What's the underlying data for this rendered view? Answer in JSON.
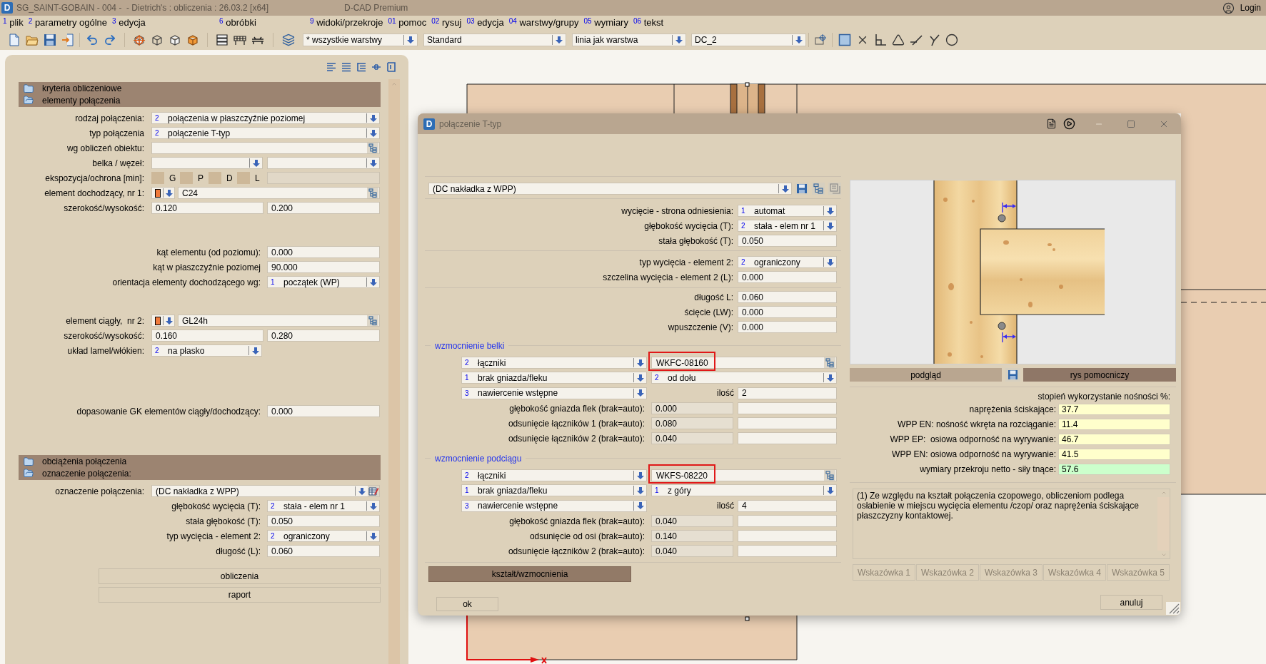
{
  "window": {
    "logo": "D",
    "title": "SG_SAINT-GOBAIN - 004 -  - Dietrich's : obliczenia : 26.03.2 [x64]",
    "app_name": "D-CAD Premium",
    "login": "Login"
  },
  "menu": [
    [
      {
        "number": "1",
        "label": "plik"
      },
      {
        "number": "2",
        "label": "parametry ogólne"
      },
      {
        "number": "3",
        "label": "edycja"
      }
    ],
    [
      {
        "number": "6",
        "label": "obróbki"
      }
    ],
    [
      {
        "number": "9",
        "label": "widoki/przekroje"
      },
      {
        "number": "01",
        "label": "pomoc"
      },
      {
        "number": "02",
        "label": "rysuj"
      },
      {
        "number": "03",
        "label": "edycja"
      },
      {
        "number": "04",
        "label": "warstwy/grupy"
      },
      {
        "number": "05",
        "label": "wymiary"
      },
      {
        "number": "06",
        "label": "tekst"
      }
    ]
  ],
  "toolbar": {
    "dropdowns": [
      "* wszystkie warstwy",
      "Standard",
      "linia jak warstwa",
      "DC_2"
    ]
  },
  "left_panel": {
    "sections": [
      {
        "headers": [
          {
            "label": "kryteria obliczeniowe",
            "expanded": false
          },
          {
            "label": "elementy połączenia",
            "expanded": true
          }
        ],
        "groups": [
          [
            {
              "kind": "select",
              "label": "rodzaj połączenia:",
              "number": "2",
              "value": "połączenia w płaszczyźnie poziomej"
            },
            {
              "kind": "select",
              "label": "typ połączenia",
              "number": "2",
              "value": "połączenie T-typ"
            },
            {
              "kind": "lookup",
              "label": "wg obliczeń obiektu:"
            },
            {
              "kind": "select_pair",
              "label": "belka / węzeł:"
            },
            {
              "kind": "exposure",
              "label": "ekspozycja/ochrona [min]:",
              "options": [
                {
                  "label": "G",
                  "checked": false
                },
                {
                  "label": "P",
                  "checked": false
                },
                {
                  "label": "D",
                  "checked": false
                },
                {
                  "label": "L",
                  "checked": false
                }
              ]
            },
            {
              "kind": "material",
              "label": "element dochodzący, nr 1:",
              "color": "#f07a3c",
              "value": "C24"
            },
            {
              "kind": "pair",
              "label": "szerokość/wysokość:",
              "values": [
                "0.120",
                "0.200"
              ]
            }
          ],
          [
            {
              "kind": "value_right",
              "label": "kąt elementu (od poziomu):",
              "value": "0.000"
            },
            {
              "kind": "value_right",
              "label": "kąt w płaszczyźnie poziomej",
              "value": "90.000"
            },
            {
              "kind": "select_right",
              "label": "orientacja elementy dochodzącego wg:",
              "number": "1",
              "value": "początek (WP)"
            }
          ],
          [
            {
              "kind": "material",
              "label": "element ciągły,  nr 2:",
              "color": "#f07a3c",
              "value": "GL24h"
            },
            {
              "kind": "pair",
              "label": "szerokość/wysokość:",
              "values": [
                "0.160",
                "0.280"
              ]
            },
            {
              "kind": "select_half",
              "label": "układ lamel/włókien:",
              "number": "2",
              "value": "na płasko"
            }
          ],
          [
            {
              "kind": "value_right",
              "label": "dopasowanie GK elementów ciągły/dochodzący:",
              "value": "0.000"
            }
          ]
        ]
      },
      {
        "headers": [
          {
            "label": "obciążenia połączenia",
            "expanded": false
          },
          {
            "label": "oznaczenie połączenia:",
            "expanded": true
          }
        ],
        "groups": [
          [
            {
              "kind": "preset",
              "label": "oznaczenie połączenia:",
              "value": "(DC nakładka z WPP)"
            },
            {
              "kind": "select_right",
              "label": "głębokość wycięcia (T):",
              "number": "2",
              "value": "stała - elem nr 1"
            },
            {
              "kind": "value_right",
              "label": "stała głębokość (T):",
              "value": "0.050"
            },
            {
              "kind": "select_right",
              "label": "typ wycięcia - element 2:",
              "number": "2",
              "value": "ograniczony"
            },
            {
              "kind": "value_right",
              "label": "długość (L):",
              "value": "0.060"
            }
          ]
        ]
      }
    ],
    "buttons": [
      "obliczenia",
      "raport"
    ]
  },
  "dialog": {
    "logo": "D",
    "title": "połączenie T-typ",
    "minimize_disabled": true,
    "preset": "(DC nakładka z WPP)",
    "cut_groups": [
      [
        {
          "kind": "select",
          "label": "wycięcie - strona odniesienia:",
          "number": "1",
          "value": "automat"
        },
        {
          "kind": "select",
          "label": "głębokość wycięcia (T):",
          "number": "2",
          "value": "stała - elem nr 1"
        },
        {
          "kind": "value",
          "label": "stała głębokość (T):",
          "value": "0.050"
        }
      ],
      [
        {
          "kind": "select",
          "label": "typ wycięcia - element 2:",
          "number": "2",
          "value": "ograniczony"
        },
        {
          "kind": "value",
          "label": "szczelina wycięcia - element 2 (L):",
          "value": "0.000"
        }
      ],
      [
        {
          "kind": "value",
          "label": "długość L:",
          "value": "0.060"
        },
        {
          "kind": "value",
          "label": "ścięcie (LW):",
          "value": "0.000"
        },
        {
          "kind": "value",
          "label": "wpuszczenie (V):",
          "value": "0.000"
        }
      ]
    ],
    "reinforcements": [
      {
        "title": "wzmocnienie belki",
        "fastener": {
          "number": "2",
          "value": "łączniki"
        },
        "fastener_code": {
          "value": "WKFC-08160",
          "highlighted": true
        },
        "socket": {
          "number": "1",
          "value": "brak gniazda/fleku"
        },
        "direction": {
          "number": "2",
          "value": "od dołu"
        },
        "predrilling": {
          "number": "3",
          "value": "nawiercenie wstępne"
        },
        "quantity_label": "ilość",
        "quantity": "2",
        "offsets": [
          {
            "label": "głębokość gniazda flek (brak=auto):",
            "auto_value": "0.000"
          },
          {
            "label": "odsunięcie łączników 1 (brak=auto):",
            "auto_value": "0.080"
          },
          {
            "label": "odsunięcie łączników 2 (brak=auto):",
            "auto_value": "0.040"
          }
        ]
      },
      {
        "title": "wzmocnienie podciągu",
        "fastener": {
          "number": "2",
          "value": "łączniki"
        },
        "fastener_code": {
          "value": "WKFS-08220",
          "highlighted": true
        },
        "socket": {
          "number": "1",
          "value": "brak gniazda/fleku"
        },
        "direction": {
          "number": "1",
          "value": "z góry"
        },
        "predrilling": {
          "number": "3",
          "value": "nawiercenie wstępne"
        },
        "quantity_label": "ilość",
        "quantity": "4",
        "offsets": [
          {
            "label": "głębokość gniazda flek (brak=auto):",
            "auto_value": "0.040"
          },
          {
            "label": "odsunięcie od osi (brak=auto):",
            "auto_value": "0.140"
          },
          {
            "label": "odsunięcie łączników 2 (brak=auto):",
            "auto_value": "0.040"
          }
        ]
      }
    ],
    "shape_button": "kształt/wzmocnienia",
    "ok_button": "ok",
    "view_buttons": [
      {
        "label": "podgląd",
        "selected": false
      },
      {
        "label": "rys pomocniczy",
        "selected": true
      }
    ],
    "utilization": {
      "title": "stopień wykorzystanie nośności %:",
      "rows": [
        {
          "label": "naprężenia ściskające:",
          "value": "37.7",
          "color": "#ffffcc"
        },
        {
          "label": "WPP EN: nośność wkręta na rozciąganie:",
          "value": "11.4",
          "color": "#ffffcc"
        },
        {
          "label": "WPP EP:  osiowa odporność na wyrywanie:",
          "value": "46.7",
          "color": "#ffffcc"
        },
        {
          "label": "WPP EN: osiowa odporność na wyrywanie:",
          "value": "41.5",
          "color": "#ffffcc"
        },
        {
          "label": "wymiary przekroju netto - siły tnące:",
          "value": "57.6",
          "color": "#ccffcc"
        }
      ]
    },
    "note": "(1) Ze względu na kształt połączenia czopowego, obliczeniom podlega osłabienie w miejscu wycięcia elementu /czop/ oraz naprężenia ściskające płaszczyzny kontaktowej.",
    "hint_buttons": [
      {
        "label": "Wskazówka 1",
        "disabled": true
      },
      {
        "label": "Wskazówka 2",
        "disabled": true
      },
      {
        "label": "Wskazówka 3",
        "disabled": true
      },
      {
        "label": "Wskazówka 4",
        "disabled": true
      },
      {
        "label": "Wskazówka 5",
        "disabled": true
      }
    ],
    "cancel_button": "anuluj"
  }
}
